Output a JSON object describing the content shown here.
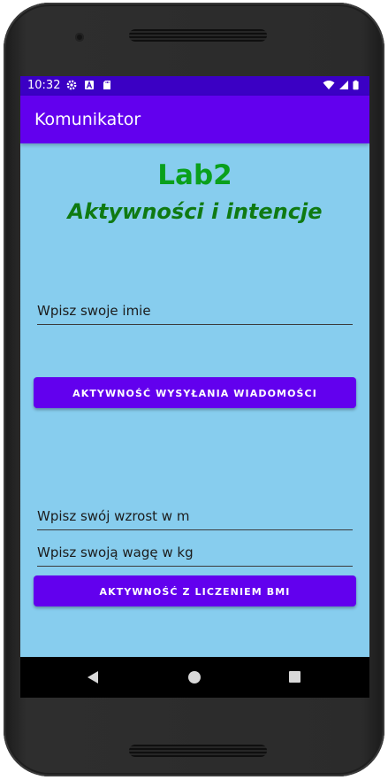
{
  "status_bar": {
    "time": "10:32",
    "left_icons": [
      "settings-icon",
      "a-badge-icon",
      "sd-card-icon"
    ],
    "right_icons": [
      "wifi-icon",
      "cell-signal-icon",
      "battery-icon"
    ]
  },
  "app_bar": {
    "title": "Komunikator"
  },
  "content": {
    "heading": "Lab2",
    "subheading": "Aktywności i intencje",
    "name_field": {
      "placeholder": "Wpisz swoje imie",
      "value": ""
    },
    "message_button_label": "AKTYWNOŚĆ WYSYŁANIA WIADOMOŚCI",
    "height_field": {
      "placeholder": "Wpisz swój wzrost w m",
      "value": ""
    },
    "weight_field": {
      "placeholder": "Wpisz swoją wagę w kg",
      "value": ""
    },
    "bmi_button_label": "AKTYWNOŚĆ Z LICZENIEM BMI"
  },
  "colors": {
    "status_bar": "#3b00c4",
    "app_bar": "#6200ee",
    "background": "#87cdee",
    "heading": "#0aa01c",
    "subheading": "#0f7a12",
    "button": "#6200ee"
  },
  "nav_bar": {
    "icons": [
      "back-icon",
      "home-icon",
      "recents-icon"
    ]
  }
}
